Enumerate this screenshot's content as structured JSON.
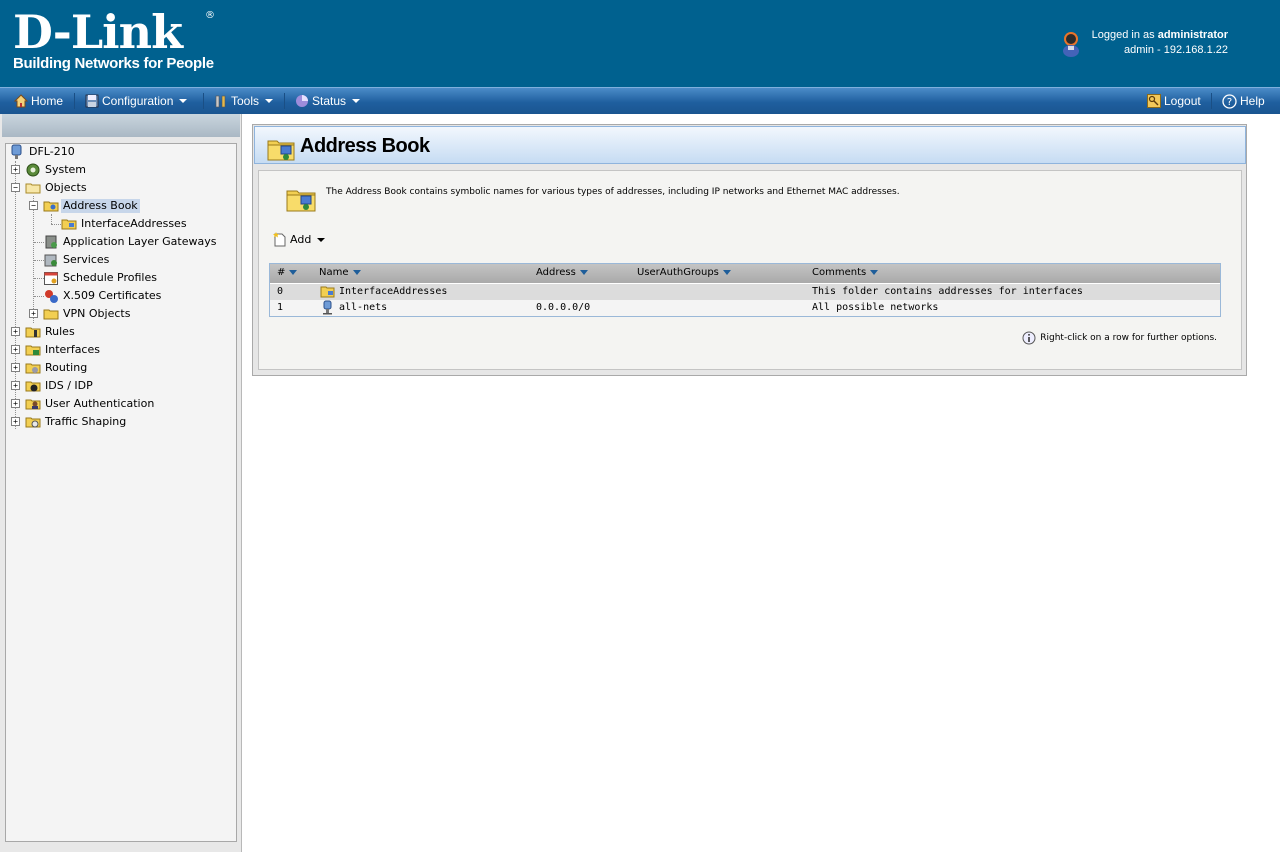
{
  "header": {
    "brand": "D-Link",
    "registered": "®",
    "tagline": "Building Networks for People",
    "logged_in_prefix": "Logged in as ",
    "user": "administrator",
    "session": "admin - 192.168.1.22"
  },
  "menu": {
    "home": "Home",
    "configuration": "Configuration",
    "tools": "Tools",
    "status": "Status",
    "logout": "Logout",
    "help": "Help"
  },
  "tree": {
    "root": "DFL-210",
    "items": [
      {
        "label": "System",
        "icon": "gear-icon"
      },
      {
        "label": "Objects",
        "icon": "folder-icon"
      },
      {
        "label": "Address Book",
        "icon": "address-book-icon"
      },
      {
        "label": "InterfaceAddresses",
        "icon": "address-folder-icon"
      },
      {
        "label": "Application Layer Gateways",
        "icon": "alg-icon"
      },
      {
        "label": "Services",
        "icon": "services-icon"
      },
      {
        "label": "Schedule Profiles",
        "icon": "calendar-icon"
      },
      {
        "label": "X.509 Certificates",
        "icon": "certificate-icon"
      },
      {
        "label": "VPN Objects",
        "icon": "folder-icon"
      },
      {
        "label": "Rules",
        "icon": "rules-icon"
      },
      {
        "label": "Interfaces",
        "icon": "interfaces-icon"
      },
      {
        "label": "Routing",
        "icon": "routing-icon"
      },
      {
        "label": "IDS / IDP",
        "icon": "ids-icon"
      },
      {
        "label": "User Authentication",
        "icon": "user-auth-icon"
      },
      {
        "label": "Traffic Shaping",
        "icon": "traffic-shaping-icon"
      }
    ]
  },
  "main": {
    "title": "Address Book",
    "description": "The Address Book contains symbolic names for various types of addresses, including IP networks and Ethernet MAC addresses.",
    "add_label": "Add",
    "columns": [
      "#",
      "Name",
      "Address",
      "UserAuthGroups",
      "Comments"
    ],
    "rows": [
      {
        "index": "0",
        "name": "InterfaceAddresses",
        "address": "",
        "groups": "",
        "comments": "This folder contains addresses for interfaces"
      },
      {
        "index": "1",
        "name": "all-nets",
        "address": "0.0.0.0/0",
        "groups": "",
        "comments": "All possible networks"
      }
    ],
    "hint": "Right-click on a row for further options."
  },
  "colors": {
    "header_bg": "#00618f",
    "menubar": "#1f5f9f",
    "selection": "#c7d6ea"
  }
}
